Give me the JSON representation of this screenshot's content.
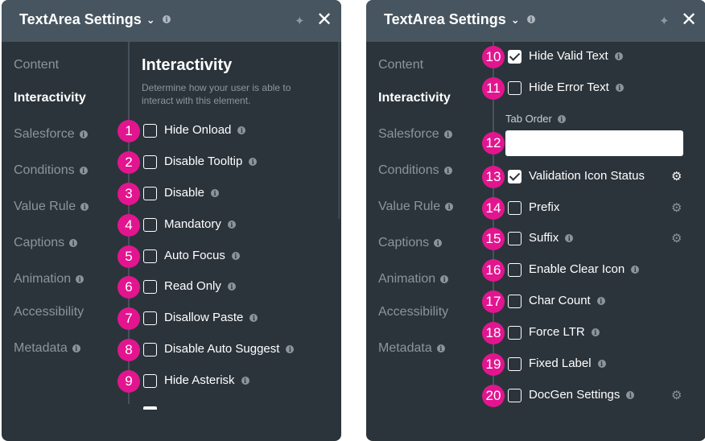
{
  "left_panel": {
    "title": "TextArea Settings",
    "nav": [
      {
        "label": "Content",
        "info": false,
        "active": false
      },
      {
        "label": "Interactivity",
        "info": false,
        "active": true
      },
      {
        "label": "Salesforce",
        "info": true,
        "active": false
      },
      {
        "label": "Conditions",
        "info": true,
        "active": false
      },
      {
        "label": "Value Rule",
        "info": true,
        "active": false
      },
      {
        "label": "Captions",
        "info": true,
        "active": false
      },
      {
        "label": "Animation",
        "info": true,
        "active": false
      },
      {
        "label": "Accessibility",
        "info": false,
        "active": false
      },
      {
        "label": "Metadata",
        "info": true,
        "active": false
      }
    ],
    "section_title": "Interactivity",
    "section_desc": "Determine how your user is able to interact with this element.",
    "options": [
      {
        "step": "1",
        "label": "Hide Onload",
        "checked": false
      },
      {
        "step": "2",
        "label": "Disable Tooltip",
        "checked": false
      },
      {
        "step": "3",
        "label": "Disable",
        "checked": false
      },
      {
        "step": "4",
        "label": "Mandatory",
        "checked": false
      },
      {
        "step": "5",
        "label": "Auto Focus",
        "checked": false
      },
      {
        "step": "6",
        "label": "Read Only",
        "checked": false
      },
      {
        "step": "7",
        "label": "Disallow Paste",
        "checked": false
      },
      {
        "step": "8",
        "label": "Disable Auto Suggest",
        "checked": false
      },
      {
        "step": "9",
        "label": "Hide Asterisk",
        "checked": false
      }
    ]
  },
  "right_panel": {
    "title": "TextArea Settings",
    "nav": [
      {
        "label": "Content",
        "info": false,
        "active": false
      },
      {
        "label": "Interactivity",
        "info": false,
        "active": true
      },
      {
        "label": "Salesforce",
        "info": true,
        "active": false
      },
      {
        "label": "Conditions",
        "info": true,
        "active": false
      },
      {
        "label": "Value Rule",
        "info": true,
        "active": false
      },
      {
        "label": "Captions",
        "info": true,
        "active": false
      },
      {
        "label": "Animation",
        "info": true,
        "active": false
      },
      {
        "label": "Accessibility",
        "info": false,
        "active": false
      },
      {
        "label": "Metadata",
        "info": true,
        "active": false
      }
    ],
    "options_top": [
      {
        "step": "10",
        "label": "Hide Valid Text",
        "checked": true,
        "gear": false
      },
      {
        "step": "11",
        "label": "Hide Error Text",
        "checked": false,
        "gear": false
      }
    ],
    "tab_order": {
      "step": "12",
      "label": "Tab Order",
      "value": ""
    },
    "options_bottom": [
      {
        "step": "13",
        "label": "Validation Icon Status",
        "checked": true,
        "gear": true,
        "info": false
      },
      {
        "step": "14",
        "label": "Prefix",
        "checked": false,
        "gear": true,
        "info": false
      },
      {
        "step": "15",
        "label": "Suffix",
        "checked": false,
        "gear": true,
        "info": true
      },
      {
        "step": "16",
        "label": "Enable Clear Icon",
        "checked": false,
        "gear": false,
        "info": true
      },
      {
        "step": "17",
        "label": "Char Count",
        "checked": false,
        "gear": false,
        "info": true
      },
      {
        "step": "18",
        "label": "Force LTR",
        "checked": false,
        "gear": false,
        "info": true
      },
      {
        "step": "19",
        "label": "Fixed Label",
        "checked": false,
        "gear": false,
        "info": true
      },
      {
        "step": "20",
        "label": "DocGen Settings",
        "checked": false,
        "gear": true,
        "info": true
      }
    ]
  },
  "colors": {
    "panel_bg": "#2b343b",
    "header_bg": "#475560",
    "step_badge": "#e2158f",
    "muted_text": "#8a959d"
  },
  "icons": {
    "chevron": "chevron-down-icon",
    "pin": "pin-icon",
    "close": "close-icon",
    "info": "info-icon",
    "gear": "gear-icon",
    "check": "checkmark-icon"
  }
}
